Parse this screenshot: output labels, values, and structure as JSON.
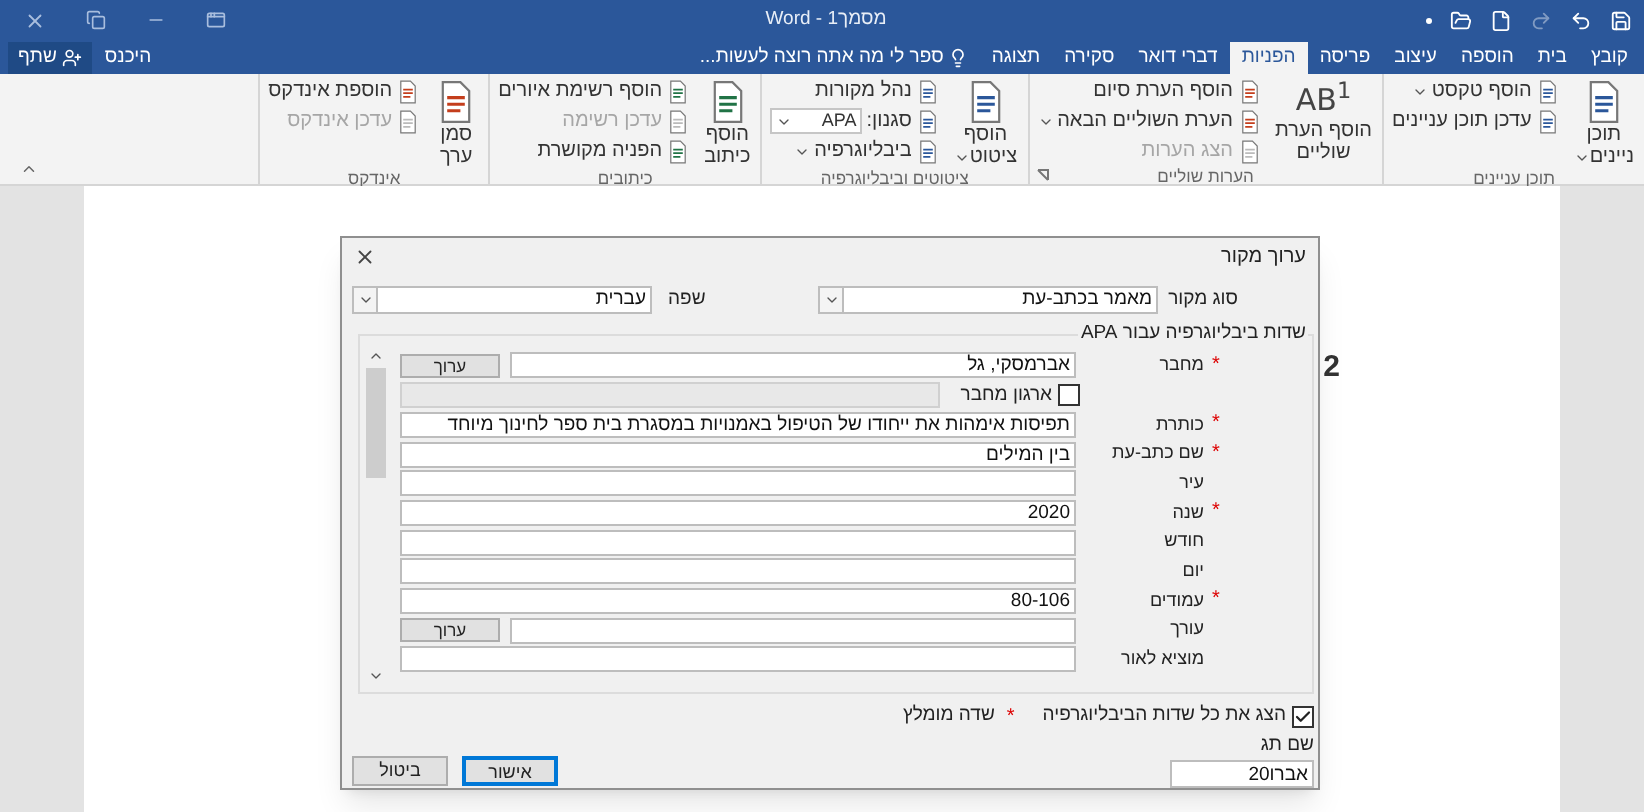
{
  "title_bar": {
    "title": "מסמך1 - Word"
  },
  "ribbon_tabs": [
    {
      "label": "קובץ",
      "selected": false
    },
    {
      "label": "בית",
      "selected": false
    },
    {
      "label": "הוספה",
      "selected": false
    },
    {
      "label": "עיצוב",
      "selected": false
    },
    {
      "label": "פריסה",
      "selected": false
    },
    {
      "label": "הפניות",
      "selected": true
    },
    {
      "label": "דברי דואר",
      "selected": false
    },
    {
      "label": "סקירה",
      "selected": false
    },
    {
      "label": "תצוגה",
      "selected": false
    }
  ],
  "tell_me": "ספר לי מה אתה רוצה לעשות...",
  "account": {
    "sign_in": "היכנס",
    "share": "שתף"
  },
  "ribbon_groups": [
    {
      "label": "תוכן עניינים",
      "dialog_launcher": false,
      "columns": [
        [
          {
            "kind": "large",
            "lines": [
              "תוכן",
              "ניינים"
            ],
            "dropdown": true
          }
        ],
        [
          {
            "kind": "small",
            "label": "הוסף טקסט",
            "dropdown": true,
            "disabled": false
          },
          {
            "kind": "small",
            "label": "עדכן תוכן עניינים",
            "dropdown": false,
            "disabled": false
          }
        ]
      ]
    },
    {
      "label": "הערות שוליים",
      "dialog_launcher": true,
      "columns": [
        [
          {
            "kind": "large",
            "icon_text": "AB$^{1}$",
            "lines": [
              "הוסף הערת",
              "שוליים"
            ],
            "dropdown": false
          }
        ],
        [
          {
            "kind": "small",
            "label": "הוסף הערת סיום",
            "dropdown": false,
            "disabled": false
          },
          {
            "kind": "small",
            "label": "הערת השוליים הבאה",
            "dropdown": true,
            "disabled": false
          },
          {
            "kind": "small",
            "label": "הצג הערות",
            "dropdown": false,
            "disabled": true
          }
        ]
      ]
    },
    {
      "label": "ציטוטים וביבליוגרפיה",
      "dialog_launcher": false,
      "columns": [
        [
          {
            "kind": "large",
            "lines": [
              "הוסף",
              "ציטוט"
            ],
            "dropdown": true
          }
        ],
        [
          {
            "kind": "small",
            "label": "נהל מקורות",
            "dropdown": false,
            "disabled": false
          },
          {
            "kind": "style",
            "label": "סגנון:",
            "value": "APA"
          },
          {
            "kind": "small",
            "label": "ביבליוגרפיה",
            "dropdown": true,
            "disabled": false
          }
        ]
      ]
    },
    {
      "label": "כיתובים",
      "dialog_launcher": false,
      "columns": [
        [
          {
            "kind": "large",
            "lines": [
              "הוסף",
              "כיתוב"
            ],
            "dropdown": false
          }
        ],
        [
          {
            "kind": "small",
            "label": "הוסף רשימת איורים",
            "dropdown": false,
            "disabled": false
          },
          {
            "kind": "small",
            "label": "עדכן רשימה",
            "dropdown": false,
            "disabled": true
          },
          {
            "kind": "small",
            "label": "הפניה מקושרת",
            "dropdown": false,
            "disabled": false
          }
        ]
      ]
    },
    {
      "label": "אינדקס",
      "dialog_launcher": false,
      "columns": [
        [
          {
            "kind": "large",
            "lines": [
              "סמן",
              "ערך"
            ],
            "dropdown": false
          }
        ],
        [
          {
            "kind": "small",
            "label": "הוספת אינדקס",
            "dropdown": false,
            "disabled": false
          },
          {
            "kind": "small",
            "label": "עדכן אינדקס",
            "dropdown": false,
            "disabled": true
          }
        ]
      ]
    }
  ],
  "document": {
    "visible_text": "2"
  },
  "dialog": {
    "title": "ערוך מקור",
    "required_mark": "*",
    "source_type": {
      "label": "סוג מקור",
      "value": "מאמר בכתב-עת"
    },
    "language": {
      "label": "שפה",
      "value": "עברית"
    },
    "fields_group": {
      "title": "שדות ביבליוגרפיה עבור APA",
      "rows": [
        {
          "kind": "field",
          "label": "מחבר",
          "required": true,
          "value": "אברמסקי, גל",
          "edit_button": "ערוך"
        },
        {
          "kind": "checkbox",
          "label": "ארגון מחבר",
          "checked": false
        },
        {
          "kind": "field",
          "label": "כותרת",
          "required": true,
          "value": "תפיסות אימהות את ייחודו של הטיפול באמנויות במסגרת בית ספר לחינוך מיוחד"
        },
        {
          "kind": "field",
          "label": "שם כתב-עת",
          "required": true,
          "value": "בין המילים"
        },
        {
          "kind": "field",
          "label": "עיר",
          "required": false
        },
        {
          "kind": "field",
          "label": "שנה",
          "required": true,
          "value": "2020"
        },
        {
          "kind": "field",
          "label": "חודש",
          "required": false
        },
        {
          "kind": "field",
          "label": "יום",
          "required": false
        },
        {
          "kind": "field",
          "label": "עמודים",
          "required": true,
          "value": "80-106"
        },
        {
          "kind": "field",
          "label": "עורך",
          "required": false,
          "edit_button": "ערוך"
        },
        {
          "kind": "field",
          "label": "מוציא לאור",
          "required": false
        }
      ]
    },
    "show_all": {
      "label": "הצג את כל שדות הביבליוגרפיה",
      "checked": true
    },
    "recommended_note": "שדה מומלץ",
    "tag_name": {
      "label": "שם תג",
      "value": "אברו20"
    },
    "buttons": [
      {
        "label": "אישור",
        "default": true
      },
      {
        "label": "ביטול",
        "default": false
      }
    ]
  }
}
